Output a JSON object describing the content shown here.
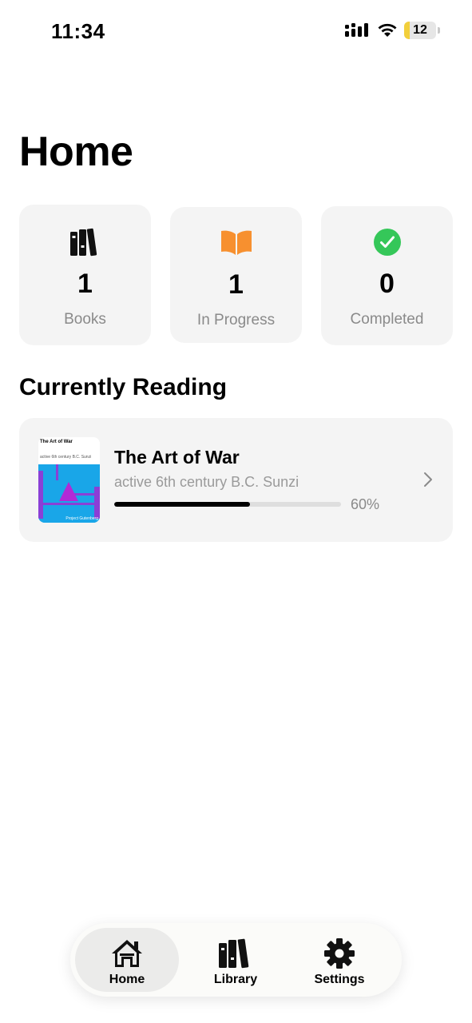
{
  "status_bar": {
    "time": "11:34",
    "battery": "12"
  },
  "page_title": "Home",
  "stats": [
    {
      "icon": "books-icon",
      "value": "1",
      "label": "Books"
    },
    {
      "icon": "open-book-icon",
      "value": "1",
      "label": "In Progress",
      "color": "#f7902f"
    },
    {
      "icon": "checkmark-circle-icon",
      "value": "0",
      "label": "Completed",
      "color": "#35c759"
    }
  ],
  "section_title": "Currently Reading",
  "current_book": {
    "title": "The Art of War",
    "author": "active 6th century B.C. Sunzi",
    "progress": 60,
    "progress_label": "60%",
    "cover": {
      "title": "The Art of War",
      "author": "active 6th century B.C. Sunzi",
      "publisher": "Project Gutenberg"
    }
  },
  "tabs": [
    {
      "label": "Home",
      "icon": "house-icon",
      "active": true
    },
    {
      "label": "Library",
      "icon": "books-icon",
      "active": false
    },
    {
      "label": "Settings",
      "icon": "gear-icon",
      "active": false
    }
  ]
}
